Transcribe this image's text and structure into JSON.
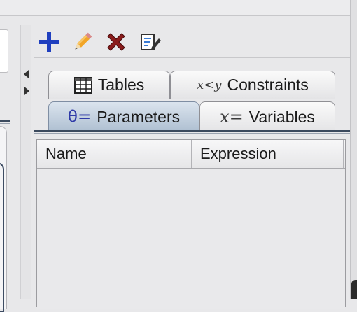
{
  "toolbar": {
    "buttons": [
      {
        "icon": "plus-icon",
        "action": "add",
        "color": "#1f3fbf"
      },
      {
        "icon": "pencil-icon",
        "action": "edit",
        "color": "#f0a020"
      },
      {
        "icon": "delete-x-icon",
        "action": "delete",
        "color": "#8b1c1c"
      },
      {
        "icon": "edit-document-icon",
        "action": "edit-document",
        "color": "#3a3a3a"
      }
    ]
  },
  "tabs": {
    "row_back": [
      {
        "label": "Tables",
        "icon": "table-grid-icon"
      },
      {
        "label": "Constraints",
        "icon_text": "x<y"
      }
    ],
    "row_front": [
      {
        "label": "Parameters",
        "icon_text": "θ=",
        "selected": true
      },
      {
        "label": "Variables",
        "icon_text": "x="
      }
    ]
  },
  "table": {
    "columns": [
      "Name",
      "Expression"
    ],
    "rows": []
  },
  "colors": {
    "selected_tab": "#aebfd1",
    "accent_line": "#3b4a5e",
    "theta_color": "#2f3aa8"
  }
}
